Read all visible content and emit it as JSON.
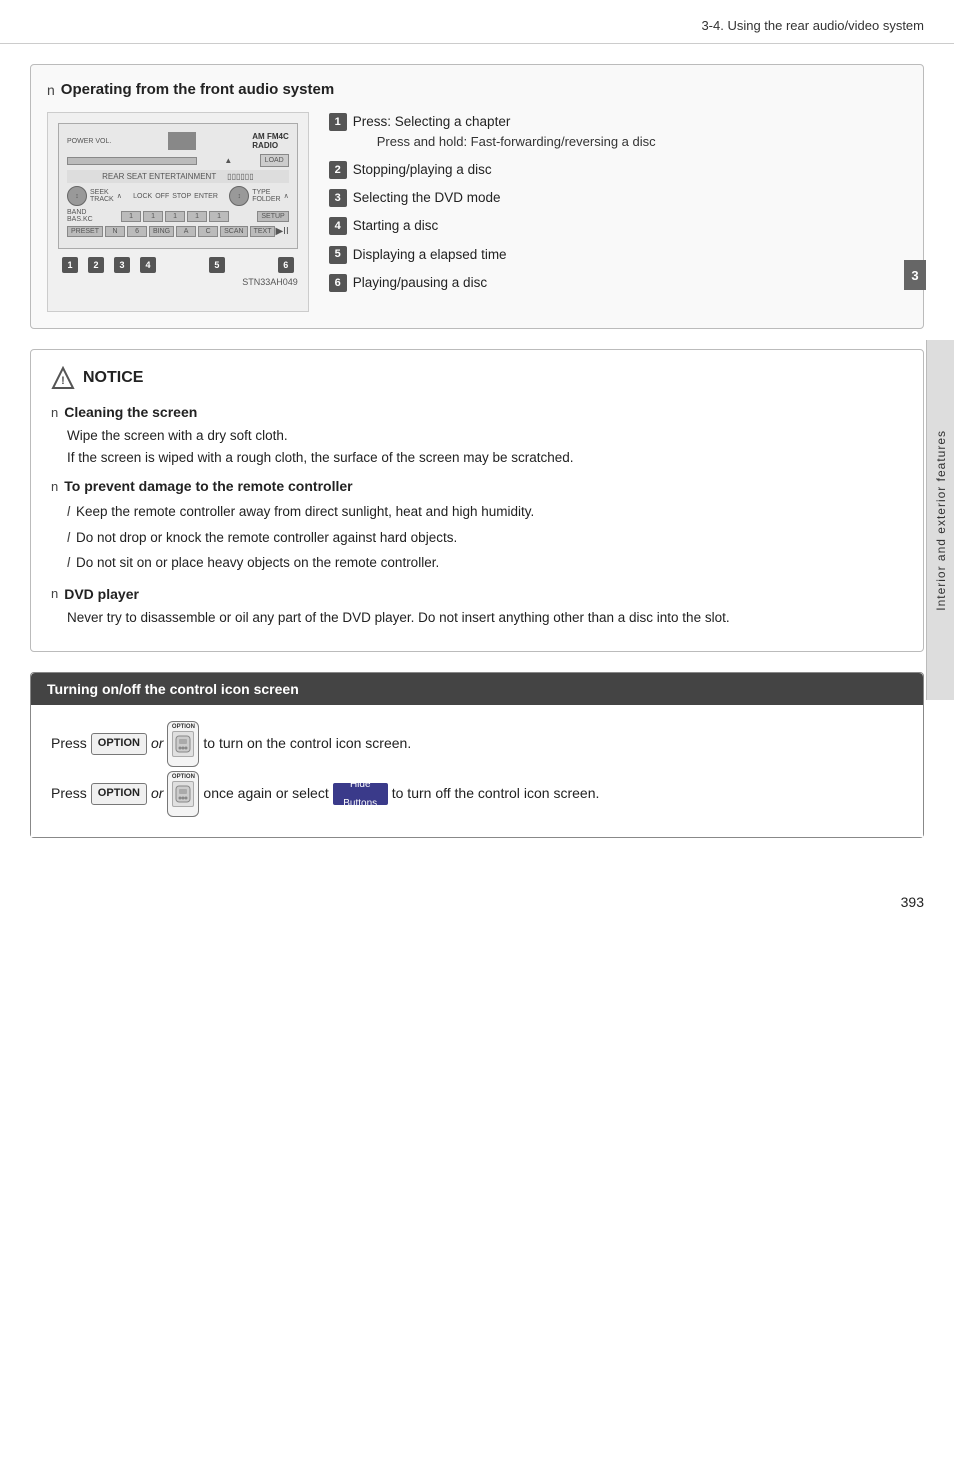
{
  "header": {
    "title": "3-4. Using the rear audio/video system"
  },
  "operating_section": {
    "heading_bullet": "n",
    "heading": "Operating from the front audio system",
    "diagram_caption": "STN33AH049",
    "steps": [
      {
        "number": "1",
        "main": "Press: Selecting a chapter",
        "sub": "Press and hold: Fast-forwarding/reversing a disc"
      },
      {
        "number": "2",
        "main": "Stopping/playing a disc",
        "sub": null
      },
      {
        "number": "3",
        "main": "Selecting the DVD mode",
        "sub": null
      },
      {
        "number": "4",
        "main": "Starting a disc",
        "sub": null
      },
      {
        "number": "5",
        "main": "Displaying a elapsed time",
        "sub": null
      },
      {
        "number": "6",
        "main": "Playing/pausing a disc",
        "sub": null
      }
    ]
  },
  "notice_section": {
    "title": "NOTICE",
    "items": [
      {
        "bullet": "n",
        "heading": "Cleaning the screen",
        "body": [
          "Wipe the screen with a dry soft cloth.",
          "If the screen is wiped with a rough cloth, the surface of the screen may be scratched."
        ]
      },
      {
        "bullet": "n",
        "heading": "To prevent damage to the remote controller",
        "list": [
          "Keep the remote controller away from direct sunlight, heat and high humidity.",
          "Do not drop or knock the remote controller against hard objects.",
          "Do not sit on or place heavy objects on the remote controller."
        ]
      },
      {
        "bullet": "n",
        "heading": "DVD player",
        "body": [
          "Never try to disassemble or oil any part of the DVD player. Do not insert anything other than a disc into the slot."
        ]
      }
    ]
  },
  "turning_section": {
    "title": "Turning on/off the control icon screen",
    "line1_prefix": "Press",
    "line1_btn1": "OPTION",
    "line1_or": "or",
    "line1_btn2": "OPTION",
    "line1_suffix": "to turn on the control icon screen.",
    "line2_prefix": "Press",
    "line2_btn1": "OPTION",
    "line2_or": "or",
    "line2_btn2": "OPTION",
    "line2_middle": "once again or select",
    "line2_hide": "Hide\nButtons",
    "line2_suffix": "to turn off the control",
    "line2_end": "icon screen."
  },
  "sidebar": {
    "label": "Interior and exterior features"
  },
  "page_number": "393",
  "chapter_number": "3"
}
